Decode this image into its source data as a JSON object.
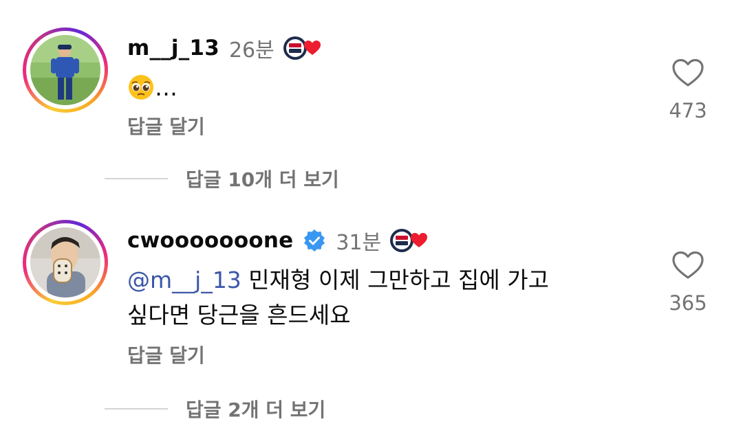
{
  "comments": [
    {
      "username": "m__j_13",
      "time": "26분",
      "verified": false,
      "text": "…",
      "emoji": "pleading-face",
      "reply_label": "답글 달기",
      "likes": "473",
      "view_replies": "답글 10개 더 보기"
    },
    {
      "username": "cwooooooone",
      "time": "31분",
      "verified": true,
      "mention": "@m__j_13",
      "text_line1": " 민재형 이제 그만하고 집에 가고",
      "text_line2": "싶다면 당근을 흔드세요",
      "reply_label": "답글 달기",
      "likes": "365",
      "view_replies": "답글 2개 더 보기"
    }
  ],
  "colors": {
    "secondary_text": "#737373",
    "mention": "#3b57a8",
    "verified": "#3897f0",
    "heart_badge": "#ed1c2e"
  }
}
